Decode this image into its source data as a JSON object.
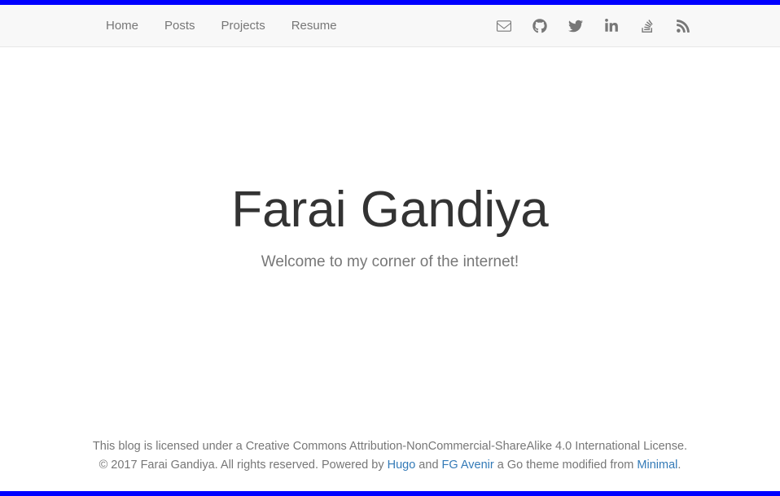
{
  "nav": {
    "items": [
      {
        "label": "Home"
      },
      {
        "label": "Posts"
      },
      {
        "label": "Projects"
      },
      {
        "label": "Resume"
      }
    ]
  },
  "hero": {
    "title": "Farai Gandiya",
    "subtitle": "Welcome to my corner of the internet!"
  },
  "footer": {
    "line1": "This blog is licensed under a Creative Commons Attribution-NonCommercial-ShareAlike 4.0 International License.",
    "copyright_prefix": "© 2017 Farai Gandiya. All rights reserved. Powered by ",
    "link_hugo": "Hugo",
    "between1": " and ",
    "link_fgavenir": "FG Avenir",
    "between2": " a Go theme modified from ",
    "link_minimal": "Minimal",
    "suffix": "."
  }
}
